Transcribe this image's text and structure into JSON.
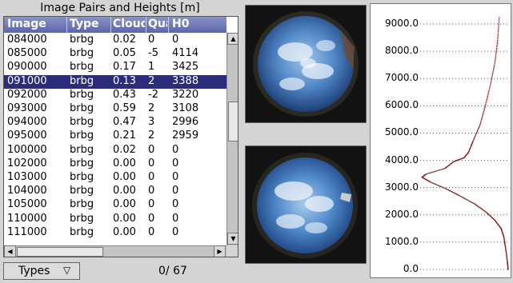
{
  "window": {
    "title": "Image Pairs and Heights [m]"
  },
  "table": {
    "columns": [
      "Image",
      "Type",
      "Cloud",
      "Quality",
      "H0"
    ],
    "selected_index": 3,
    "rows": [
      [
        "084000",
        "brbg",
        "0.02",
        "0",
        "0"
      ],
      [
        "085000",
        "brbg",
        "0.05",
        "-5",
        "4114"
      ],
      [
        "090000",
        "brbg",
        "0.17",
        "1",
        "3425"
      ],
      [
        "091000",
        "brbg",
        "0.13",
        "2",
        "3388"
      ],
      [
        "092000",
        "brbg",
        "0.43",
        "-2",
        "3220"
      ],
      [
        "093000",
        "brbg",
        "0.59",
        "2",
        "3108"
      ],
      [
        "094000",
        "brbg",
        "0.47",
        "3",
        "2996"
      ],
      [
        "095000",
        "brbg",
        "0.21",
        "2",
        "2959"
      ],
      [
        "100000",
        "brbg",
        "0.02",
        "0",
        "0"
      ],
      [
        "102000",
        "brbg",
        "0.00",
        "0",
        "0"
      ],
      [
        "103000",
        "brbg",
        "0.00",
        "0",
        "0"
      ],
      [
        "104000",
        "brbg",
        "0.00",
        "0",
        "0"
      ],
      [
        "105000",
        "brbg",
        "0.00",
        "0",
        "0"
      ],
      [
        "110000",
        "brbg",
        "0.00",
        "0",
        "0"
      ],
      [
        "111000",
        "brbg",
        "0.00",
        "0",
        "0"
      ]
    ]
  },
  "controls": {
    "types_label": "Types",
    "types_icon": "triangle-down-icon",
    "counter": "0/ 67"
  },
  "chart_data": {
    "type": "scatter",
    "title": "",
    "xlabel": "",
    "ylabel": "",
    "ylim": [
      0,
      9500
    ],
    "yticks": [
      "0.0",
      "1000.0",
      "2000.0",
      "3000.0",
      "4000.0",
      "5000.0",
      "6000.0",
      "7000.0",
      "8000.0",
      "9000.0"
    ],
    "ytick_values": [
      0,
      1000,
      2000,
      3000,
      4000,
      5000,
      6000,
      7000,
      8000,
      9000
    ],
    "xlim": [
      0,
      1
    ],
    "color": "#8b1a1a",
    "series": [
      {
        "values": [
          [
            1.0,
            0
          ],
          [
            0.99,
            300
          ],
          [
            0.97,
            800
          ],
          [
            0.95,
            1200
          ],
          [
            0.92,
            1500
          ],
          [
            0.85,
            1800
          ],
          [
            0.75,
            2100
          ],
          [
            0.62,
            2400
          ],
          [
            0.45,
            2700
          ],
          [
            0.3,
            2950
          ],
          [
            0.12,
            3200
          ],
          [
            0.02,
            3380
          ],
          [
            0.07,
            3500
          ],
          [
            0.28,
            3700
          ],
          [
            0.38,
            3950
          ],
          [
            0.5,
            4100
          ],
          [
            0.55,
            4300
          ],
          [
            0.6,
            4700
          ],
          [
            0.68,
            5300
          ],
          [
            0.74,
            6000
          ],
          [
            0.8,
            6800
          ],
          [
            0.85,
            7600
          ],
          [
            0.88,
            8400
          ],
          [
            0.9,
            9300
          ]
        ]
      }
    ]
  },
  "colors": {
    "selection": "#2b2d7c",
    "header": "#6c76b8"
  }
}
